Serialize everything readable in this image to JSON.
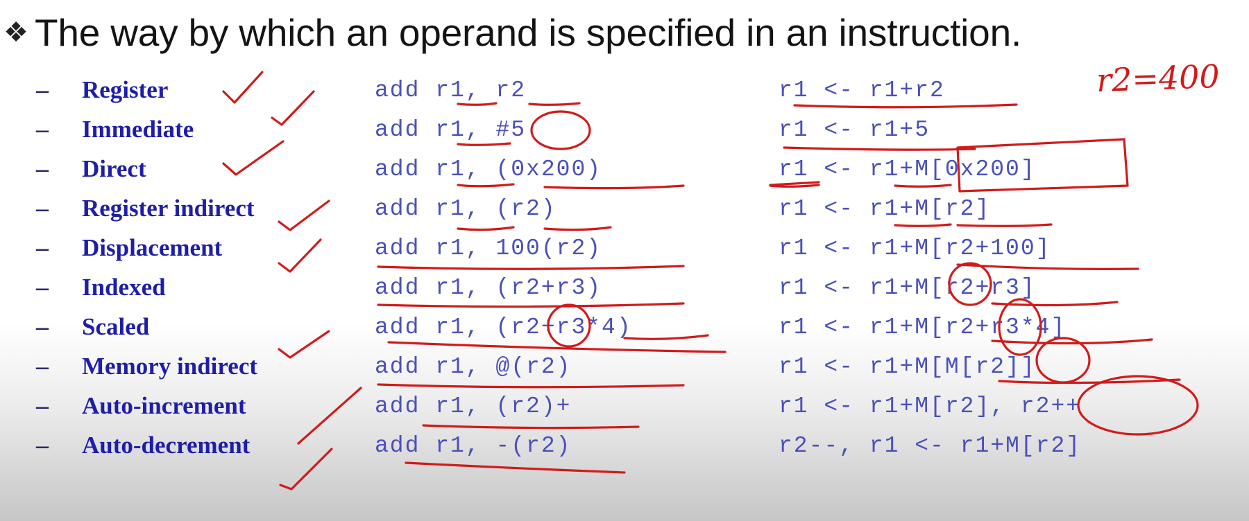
{
  "heading": {
    "bullet_icon": "diamond-bullet-icon",
    "text": "The way by which an operand is specified in an instruction."
  },
  "modes": [
    {
      "name": "Register",
      "instruction": "add r1, r2",
      "semantics": "r1 <- r1+r2"
    },
    {
      "name": "Immediate",
      "instruction": "add r1, #5",
      "semantics": "r1 <- r1+5"
    },
    {
      "name": "Direct",
      "instruction": "add r1, (0x200)",
      "semantics": "r1 <- r1+M[0x200]"
    },
    {
      "name": "Register indirect",
      "instruction": "add r1, (r2)",
      "semantics": "r1 <- r1+M[r2]"
    },
    {
      "name": "Displacement",
      "instruction": "add r1, 100(r2)",
      "semantics": "r1 <- r1+M[r2+100]"
    },
    {
      "name": "Indexed",
      "instruction": "add r1, (r2+r3)",
      "semantics": "r1 <- r1+M[r2+r3]"
    },
    {
      "name": "Scaled",
      "instruction": "add r1, (r2+r3*4)",
      "semantics": "r1 <- r1+M[r2+r3*4]"
    },
    {
      "name": "Memory indirect",
      "instruction": "add r1, @(r2)",
      "semantics": "r1 <- r1+M[M[r2]]"
    },
    {
      "name": "Auto-increment",
      "instruction": "add r1, (r2)+",
      "semantics": "r1 <- r1+M[r2], r2++"
    },
    {
      "name": "Auto-decrement",
      "instruction": "add r1, -(r2)",
      "semantics": "r2--, r1 <- r1+M[r2]"
    }
  ],
  "dash": "–",
  "annotations": {
    "handwritten_note": "r2=400",
    "ink_color": "#d21a1a"
  }
}
